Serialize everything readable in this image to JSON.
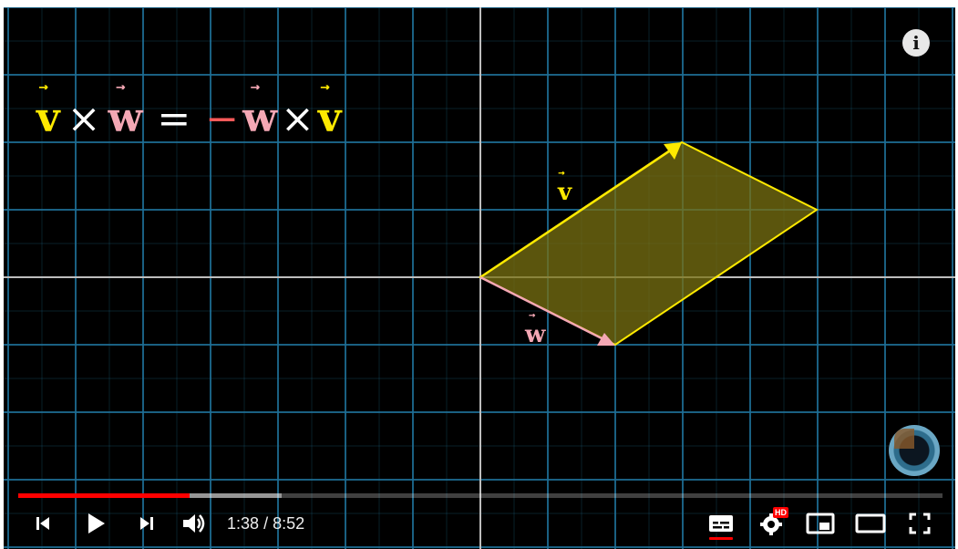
{
  "formula": {
    "v1": "v",
    "cross1": "×",
    "w1": "w",
    "eq": "=",
    "minus": "−",
    "w2": "w",
    "cross2": "×",
    "v2": "v",
    "arrow": "⃗"
  },
  "labels": {
    "v": "v",
    "w": "w"
  },
  "colors": {
    "v": "#ffea00",
    "w": "#f4a7b4",
    "area_fill": "#7a7212",
    "grid": "#1f6f95",
    "axis": "#bdbdbd",
    "progress_played": "#ff0000"
  },
  "player": {
    "info_icon": "i",
    "time_current": "1:38",
    "time_separator": "/",
    "time_total": "8:52",
    "progress_played_fraction": 0.185,
    "progress_loaded_fraction": 0.285,
    "hd_badge": "HD",
    "icons": [
      "previous-icon",
      "play-icon",
      "next-icon",
      "volume-icon",
      "captions-icon",
      "settings-icon",
      "miniplayer-icon",
      "theater-mode-icon",
      "fullscreen-icon"
    ]
  }
}
